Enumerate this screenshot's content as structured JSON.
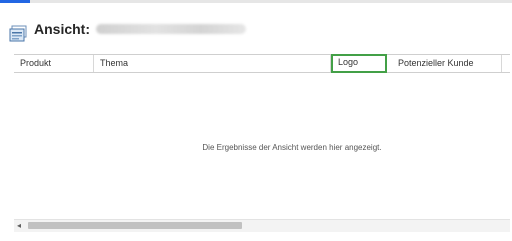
{
  "view": {
    "label": "Ansicht:",
    "icon": "view-grid-icon"
  },
  "grid": {
    "columns": [
      {
        "label": "Produkt"
      },
      {
        "label": "Thema"
      },
      {
        "label": "Logo",
        "selected": true
      },
      {
        "label": "Potenzieller Kunde"
      }
    ],
    "empty_message": "Die Ergebnisse der Ansicht werden hier angezeigt."
  },
  "colors": {
    "accent": "#2266e3",
    "selection": "#43a047"
  }
}
